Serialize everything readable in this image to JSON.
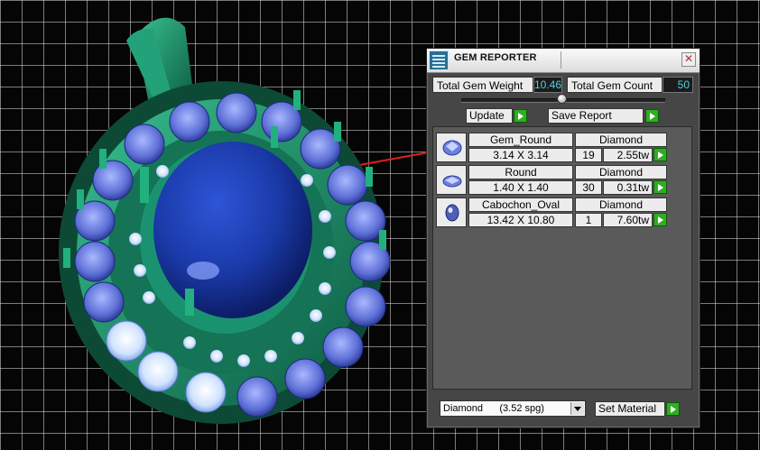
{
  "window": {
    "title": "GEM REPORTER",
    "close_glyph": "✕",
    "icon": "gem-reporter-app-icon"
  },
  "summary": {
    "weight_label": "Total Gem Weight",
    "weight_value": "10.46",
    "count_label": "Total Gem Count",
    "count_value": "50"
  },
  "actions": {
    "update_label": "Update",
    "save_report_label": "Save Report"
  },
  "gems": [
    {
      "shape": "Gem_Round",
      "material": "Diamond",
      "size": "3.14 X 3.14",
      "count": "19",
      "weight": "2.55tw",
      "thumb": "round-gem-icon"
    },
    {
      "shape": "Round",
      "material": "Diamond",
      "size": "1.40 X 1.40",
      "count": "30",
      "weight": "0.31tw",
      "thumb": "round-gem-icon"
    },
    {
      "shape": "Cabochon_Oval",
      "material": "Diamond",
      "size": "13.42 X 10.80",
      "count": "1",
      "weight": "7.60tw",
      "thumb": "oval-cabochon-icon"
    }
  ],
  "material_select": {
    "selected": "Diamond      (3.52 spg)"
  },
  "set_material_label": "Set Material",
  "colors": {
    "panel_bg": "#464646",
    "value_text": "#4fd0e0",
    "go_button": "#2fae22",
    "metal": "#1f9a72",
    "gem_blue": "#1a3fb8"
  }
}
